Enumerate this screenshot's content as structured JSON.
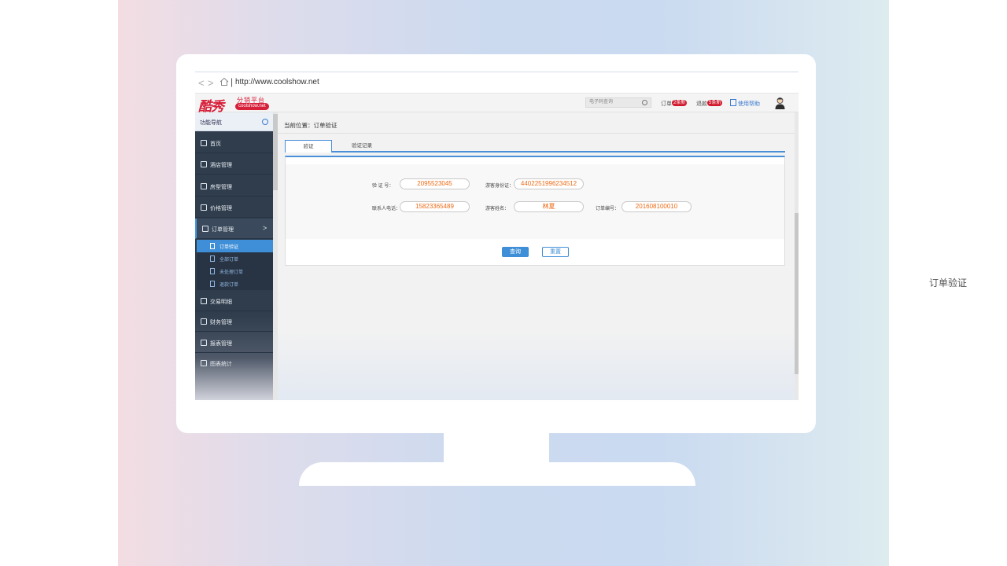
{
  "caption": "订单验证",
  "browser": {
    "url": "http://www.coolshow.net",
    "back": "<",
    "forward": ">",
    "separator": "|"
  },
  "header": {
    "logo_main": "酷秀",
    "logo_sub": "分销平台",
    "logo_domain": "coolshow.net",
    "search_placeholder": "电子码查询",
    "orders_label": "订单",
    "orders_badge": "2条新",
    "refunds_label": "退款",
    "refunds_badge": "5条新",
    "help_label": "使用帮助"
  },
  "sidebar": {
    "title": "功能导航",
    "items": [
      {
        "label": "首页",
        "icon": "home-icon"
      },
      {
        "label": "酒店管理",
        "icon": "hotel-icon"
      },
      {
        "label": "房型管理",
        "icon": "room-icon"
      },
      {
        "label": "价格管理",
        "icon": "price-icon"
      },
      {
        "label": "订单管理",
        "icon": "order-icon",
        "active": true,
        "chevron": ">"
      },
      {
        "label": "交易明细",
        "icon": "transaction-icon"
      },
      {
        "label": "财务管理",
        "icon": "finance-icon"
      },
      {
        "label": "报表管理",
        "icon": "report-icon"
      },
      {
        "label": "图表统计",
        "icon": "chart-icon"
      }
    ],
    "sub_items": [
      {
        "label": "订单验证",
        "active": true
      },
      {
        "label": "全部订单"
      },
      {
        "label": "未处理订单"
      },
      {
        "label": "退款订单"
      }
    ]
  },
  "main": {
    "breadcrumb": "当前位置：订单验证",
    "tabs": [
      {
        "label": "验证"
      },
      {
        "label": "验证记录"
      }
    ],
    "form": {
      "verify_code_label": "验 证 号：",
      "verify_code_value": "2095523045",
      "id_card_label": "游客身份证：",
      "id_card_value": "4402251996234512",
      "phone_label": "联系人电话：",
      "phone_value": "15823365489",
      "name_label": "游客姓名：",
      "name_value": "林夏",
      "order_no_label": "订单编号：",
      "order_no_value": "201608100010"
    },
    "query_button": "查询",
    "reset_button": "重置"
  },
  "colors": {
    "accent": "#3f8fd8",
    "brand": "#d7203a",
    "value": "#ee6a15",
    "sidebar": "#2f3d4d"
  }
}
